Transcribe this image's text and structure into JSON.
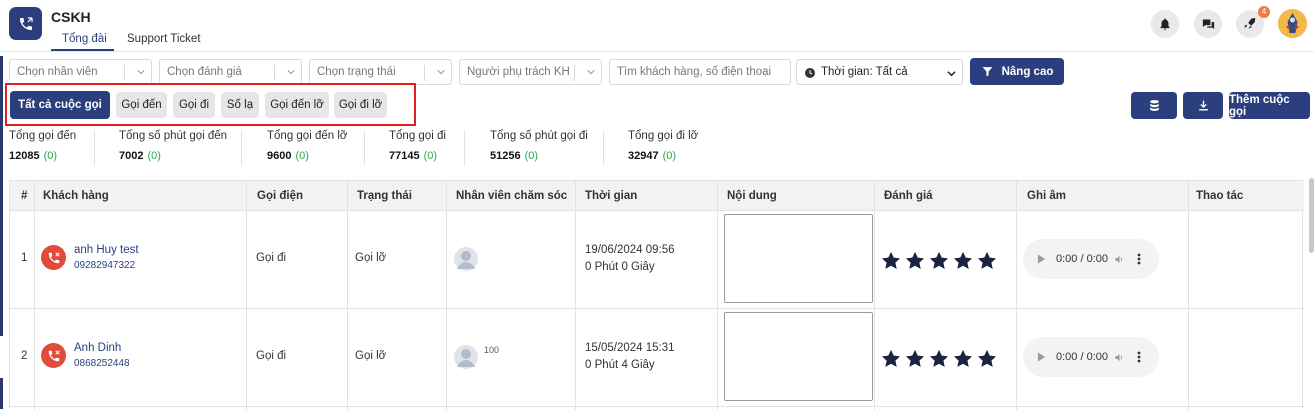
{
  "app": {
    "title": "CSKH",
    "tabs": [
      "Tổng đài",
      "Support Ticket"
    ],
    "notification_count": "4"
  },
  "filters": {
    "employee_placeholder": "Chọn nhân viên",
    "rating_placeholder": "Chọn đánh giá",
    "status_placeholder": "Chọn trạng thái",
    "owner_placeholder": "Người phụ trách KH",
    "search_placeholder": "Tìm khách hàng, số điện thoại",
    "time_label": "Thời gian: Tất cả",
    "advanced_label": "Nâng cao"
  },
  "call_tabs": [
    "Tất cả cuộc gọi",
    "Gọi đến",
    "Gọi đi",
    "Số lạ",
    "Gọi đến lỡ",
    "Gọi đi lỡ"
  ],
  "actions": {
    "add_call_label": "Thêm cuộc gọi"
  },
  "stats": [
    {
      "label": "Tổng gọi đến",
      "value": "12085",
      "extra": "(0)"
    },
    {
      "label": "Tổng số phút gọi đến",
      "value": "7002",
      "extra": "(0)"
    },
    {
      "label": "Tổng gọi đến lỡ",
      "value": "9600",
      "extra": "(0)"
    },
    {
      "label": "Tổng gọi đi",
      "value": "77145",
      "extra": "(0)"
    },
    {
      "label": "Tổng số phút gọi đi",
      "value": "51256",
      "extra": "(0)"
    },
    {
      "label": "Tổng gọi đi lỡ",
      "value": "32947",
      "extra": "(0)"
    }
  ],
  "table": {
    "columns": [
      "#",
      "Khách hàng",
      "Gọi điện",
      "Trạng thái",
      "Nhân viên chăm sóc",
      "Thời gian",
      "Nội dung",
      "Đánh giá",
      "Ghi âm",
      "Thao tác"
    ],
    "rows": [
      {
        "index": "1",
        "name": "anh Huy test",
        "phone": "09282947322",
        "call_type": "Gọi đi",
        "status": "Gọi lỡ",
        "staff_id": "",
        "datetime": "19/06/2024 09:56",
        "duration": "0 Phút 0 Giây",
        "audio_time": "0:00 / 0:00",
        "rating": 5
      },
      {
        "index": "2",
        "name": "Anh Dinh",
        "phone": "0868252448",
        "call_type": "Gọi đi",
        "status": "Gọi lỡ",
        "staff_id": "100",
        "datetime": "15/05/2024 15:31",
        "duration": "0 Phút 4 Giây",
        "audio_time": "0:00 / 0:00",
        "rating": 5
      }
    ]
  },
  "colors": {
    "primary": "#2b3f7e",
    "highlight_border": "#e21f1f",
    "positive": "#2aa84a",
    "missed_call": "#e24a3b",
    "badge": "#f57c3d"
  }
}
